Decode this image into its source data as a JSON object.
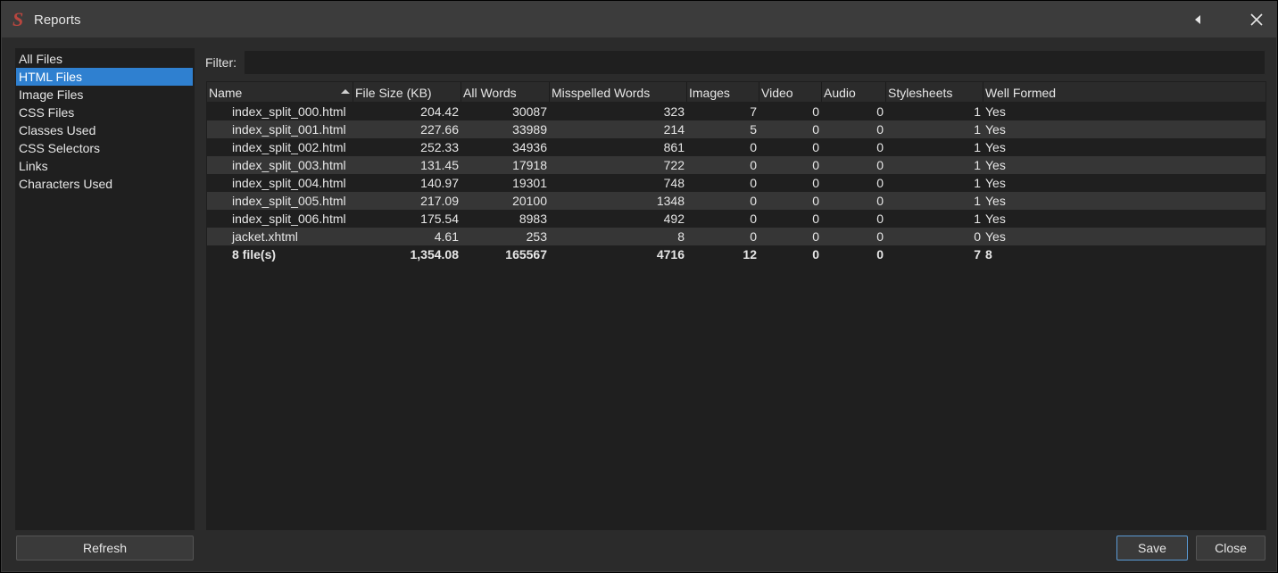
{
  "window": {
    "title": "Reports",
    "app_icon_glyph": "S",
    "colors": {
      "accent": "#2f80d0",
      "titlebar": "#3c3c3c",
      "panel": "#1f1f1f",
      "alt_row": "#363636"
    }
  },
  "sidebar": {
    "items": [
      {
        "label": "All Files",
        "selected": false
      },
      {
        "label": "HTML Files",
        "selected": true
      },
      {
        "label": "Image Files",
        "selected": false
      },
      {
        "label": "CSS Files",
        "selected": false
      },
      {
        "label": "Classes Used",
        "selected": false
      },
      {
        "label": "CSS Selectors",
        "selected": false
      },
      {
        "label": "Links",
        "selected": false
      },
      {
        "label": "Characters Used",
        "selected": false
      }
    ]
  },
  "filter": {
    "label": "Filter:",
    "value": "",
    "placeholder": ""
  },
  "table": {
    "columns": [
      "Name",
      "File Size (KB)",
      "All Words",
      "Misspelled Words",
      "Images",
      "Video",
      "Audio",
      "Stylesheets",
      "Well Formed"
    ],
    "sort_column": "Name",
    "sort_direction": "ascending",
    "rows": [
      [
        "index_split_000.html",
        "204.42",
        "30087",
        "323",
        "7",
        "0",
        "0",
        "1",
        "Yes"
      ],
      [
        "index_split_001.html",
        "227.66",
        "33989",
        "214",
        "5",
        "0",
        "0",
        "1",
        "Yes"
      ],
      [
        "index_split_002.html",
        "252.33",
        "34936",
        "861",
        "0",
        "0",
        "0",
        "1",
        "Yes"
      ],
      [
        "index_split_003.html",
        "131.45",
        "17918",
        "722",
        "0",
        "0",
        "0",
        "1",
        "Yes"
      ],
      [
        "index_split_004.html",
        "140.97",
        "19301",
        "748",
        "0",
        "0",
        "0",
        "1",
        "Yes"
      ],
      [
        "index_split_005.html",
        "217.09",
        "20100",
        "1348",
        "0",
        "0",
        "0",
        "1",
        "Yes"
      ],
      [
        "index_split_006.html",
        "175.54",
        "8983",
        "492",
        "0",
        "0",
        "0",
        "1",
        "Yes"
      ],
      [
        "jacket.xhtml",
        "4.61",
        "253",
        "8",
        "0",
        "0",
        "0",
        "0",
        "Yes"
      ]
    ],
    "total": [
      "8 file(s)",
      "1,354.08",
      "165567",
      "4716",
      "12",
      "0",
      "0",
      "7",
      "8"
    ]
  },
  "buttons": {
    "refresh": "Refresh",
    "save": "Save",
    "close": "Close"
  }
}
